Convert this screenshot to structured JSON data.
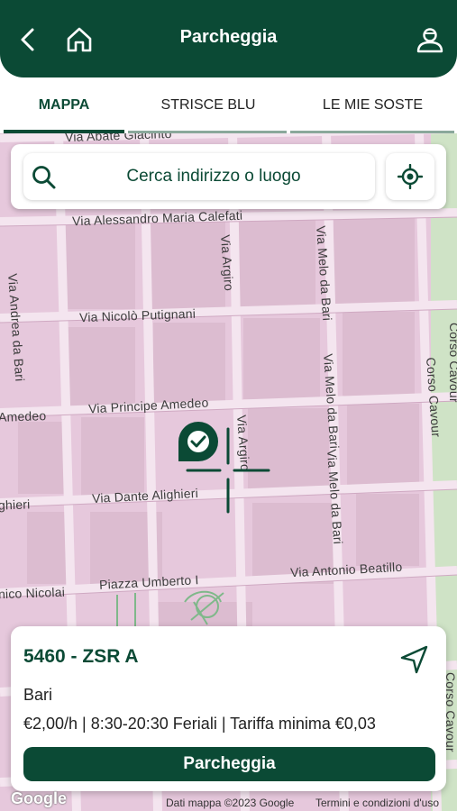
{
  "header": {
    "title": "Parcheggia",
    "left_icons": [
      "back-arrow-icon",
      "home-icon"
    ],
    "right_icon": "user-profile-icon"
  },
  "tabs": [
    {
      "label": "MAPPA",
      "active": true
    },
    {
      "label": "STRISCE BLU",
      "active": false
    },
    {
      "label": "LE MIE SOSTE",
      "active": false
    }
  ],
  "search": {
    "placeholder": "Cerca indirizzo o luogo",
    "locate_icon": "crosshair-locate-icon"
  },
  "map": {
    "streets": [
      "Via Abate Giacinto",
      "Via Alessandro Maria Calefati",
      "Via Andrea da Bari",
      "Via Argiro",
      "Via Melo da Bari",
      "Via Nicolò Putignani",
      "Corso Cavour",
      "Via Melo da Bari",
      "Corso Cavour",
      "Amedeo",
      "Via Principe Amedeo",
      "Via Argiro",
      "Via Melo da Bari",
      "ghieri",
      "Via Dante Alighieri",
      "Via Antonio Beatillo",
      "nico Nicolai",
      "Piazza Umberto I",
      "Corso Cavour"
    ]
  },
  "zone": {
    "title": "5460 - ZSR A",
    "city": "Bari",
    "details": "€2,00/h | 8:30-20:30 Feriali | Tariffa minima €0,03",
    "button_label": "Parcheggia",
    "nav_icon": "navigation-arrow-icon"
  },
  "footer": {
    "logo": "Google",
    "map_data": "Dati mappa ©2023 Google",
    "terms": "Termini e condizioni d'uso"
  },
  "colors": {
    "primary": "#0b4a35",
    "map_background": "#e6c8dc",
    "map_roads": "#f3e4ee",
    "park_green": "#b8dcb2"
  }
}
